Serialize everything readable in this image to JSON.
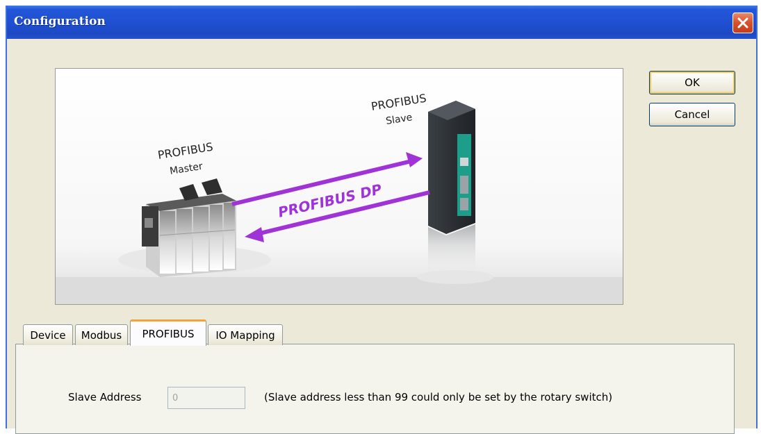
{
  "window": {
    "title": "Configuration"
  },
  "buttons": {
    "ok": "OK",
    "cancel": "Cancel"
  },
  "diagram": {
    "master_line1": "PROFIBUS",
    "master_line2": "Master",
    "slave_line1": "PROFIBUS",
    "slave_line2": "Slave",
    "link_label": "PROFIBUS DP",
    "arrow_color": "#a033d8"
  },
  "tabs": [
    {
      "label": "Device"
    },
    {
      "label": "Modbus"
    },
    {
      "label": "PROFIBUS",
      "active": true
    },
    {
      "label": "IO Mapping"
    }
  ],
  "profibus": {
    "slave_address_label": "Slave Address",
    "slave_address_value": "0",
    "hint": "(Slave address less than 99 could only be set by the rotary switch)"
  }
}
